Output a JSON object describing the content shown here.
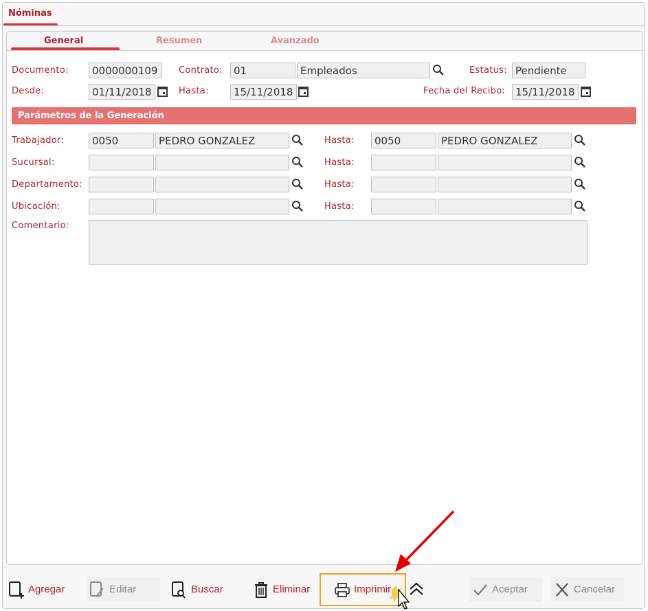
{
  "window": {
    "tab": "Nóminas"
  },
  "tabs": [
    {
      "label": "General",
      "active": true
    },
    {
      "label": "Resumen"
    },
    {
      "label": "Avanzado"
    }
  ],
  "header": {
    "documento_label": "Documento:",
    "documento": "0000000109",
    "contrato_label": "Contrato:",
    "contrato_code": "01",
    "contrato_name": "Empleados",
    "estatus_label": "Estatus:",
    "estatus": "Pendiente",
    "desde_label": "Desde:",
    "desde": "01/11/2018",
    "hasta_label": "Hasta:",
    "hasta": "15/11/2018",
    "fecha_recibo_label": "Fecha del Recibo:",
    "fecha_recibo": "15/11/2018"
  },
  "section_title": "Parámetros de la Generación",
  "params": [
    {
      "label": "Trabajador:",
      "from_code": "0050",
      "from_name": "PEDRO GONZALEZ",
      "to_label": "Hasta:",
      "to_code": "0050",
      "to_name": "PEDRO GONZALEZ"
    },
    {
      "label": "Sucursal:",
      "from_code": "",
      "from_name": "",
      "to_label": "Hasta:",
      "to_code": "",
      "to_name": ""
    },
    {
      "label": "Departamento:",
      "from_code": "",
      "from_name": "",
      "to_label": "Hasta:",
      "to_code": "",
      "to_name": ""
    },
    {
      "label": "Ubicación:",
      "from_code": "",
      "from_name": "",
      "to_label": "Hasta:",
      "to_code": "",
      "to_name": ""
    }
  ],
  "comentario_label": "Comentario:",
  "comentario": "",
  "toolbar": {
    "agregar": "Agregar",
    "editar": "Editar",
    "buscar": "Buscar",
    "eliminar": "Eliminar",
    "imprimir": "Imprimir",
    "aceptar": "Aceptar",
    "cancelar": "Cancelar"
  },
  "colors": {
    "accent": "#b0202a",
    "section": "#e47272",
    "highlight": "#f0a020",
    "arrow": "#e00000"
  }
}
